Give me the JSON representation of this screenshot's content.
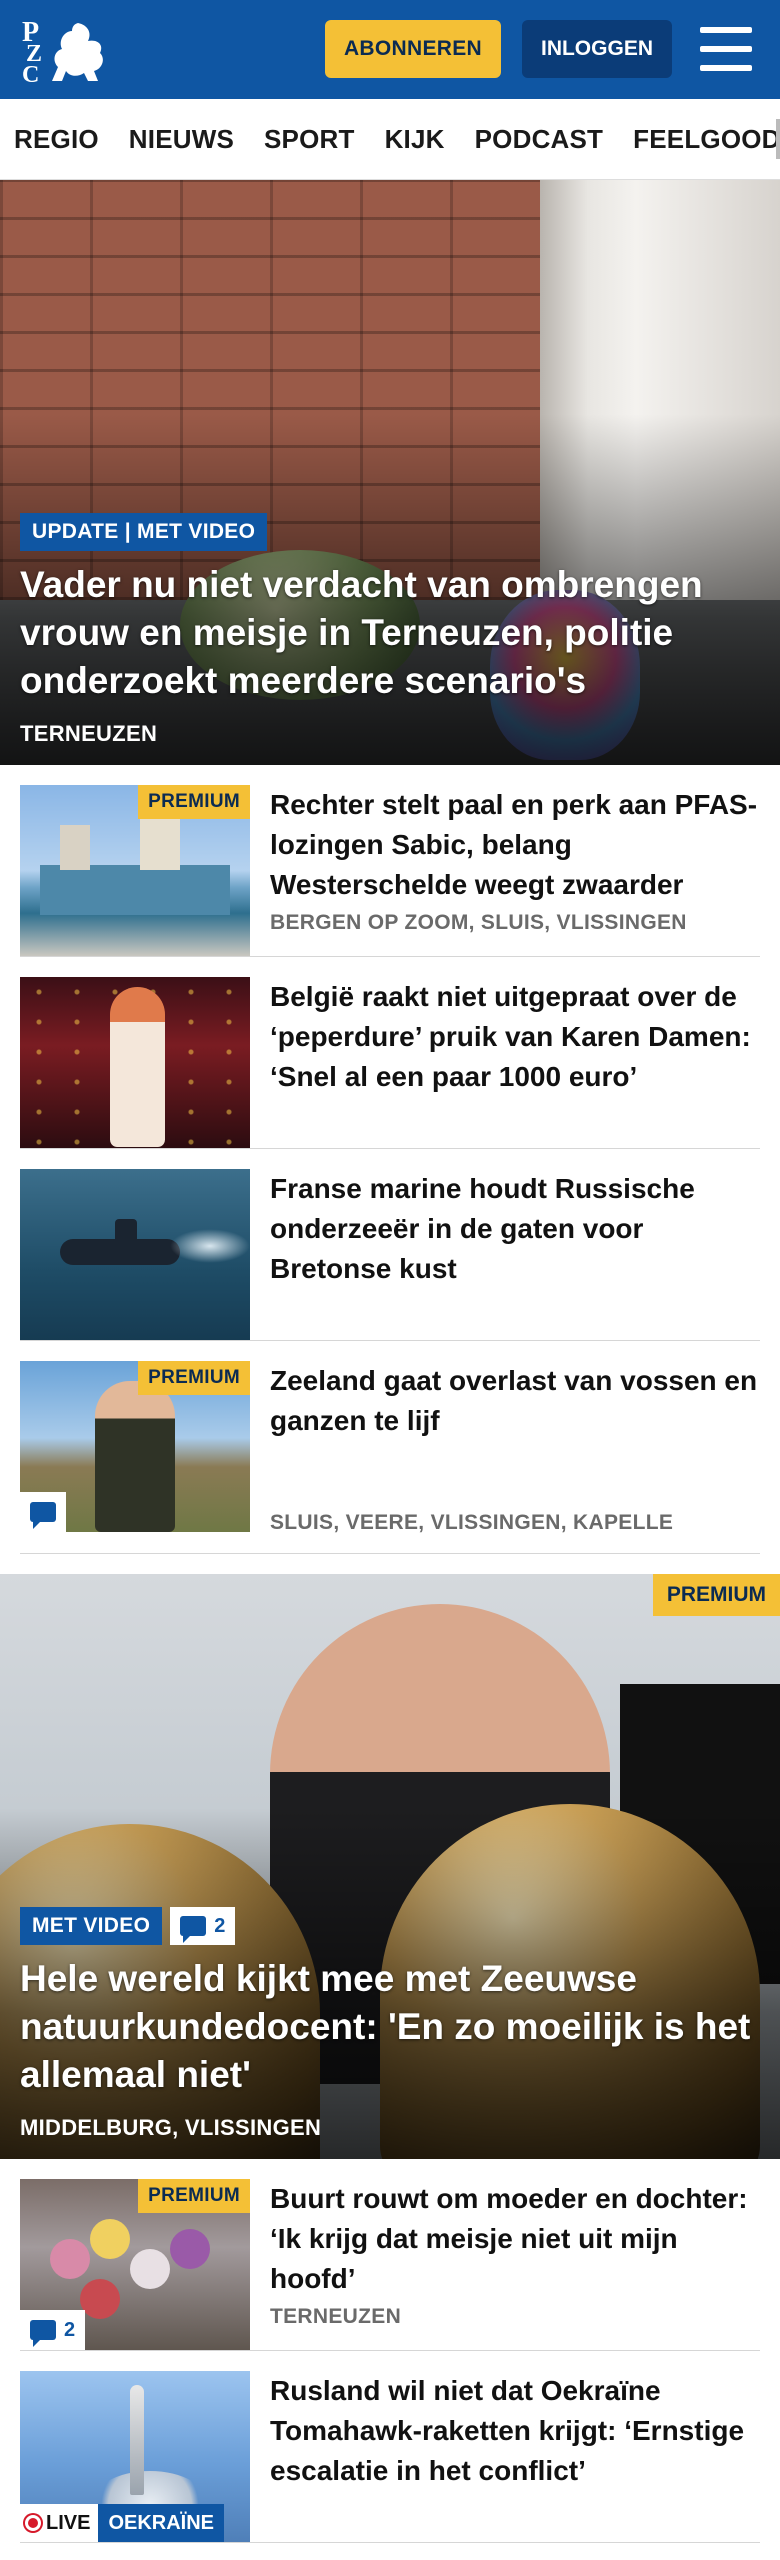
{
  "header": {
    "logo_letters": [
      "P",
      "Z",
      "C"
    ],
    "subscribe_label": "ABONNEREN",
    "login_label": "INLOGGEN"
  },
  "nav": {
    "items": [
      "REGIO",
      "NIEUWS",
      "SPORT",
      "KIJK",
      "PODCAST",
      "FEELGOOD"
    ]
  },
  "hero1": {
    "tag": "UPDATE | MET VIDEO",
    "title": "Vader nu niet verdacht van ombrengen vrouw en meisje in Terneuzen, politie onderzoekt meerdere scenario's",
    "location": "TERNEUZEN"
  },
  "articles1": [
    {
      "title": "Rechter stelt paal en perk aan PFAS-lozingen Sabic, belang Westerschelde weegt zwaarder",
      "location": "BERGEN OP ZOOM, SLUIS, VLISSINGEN",
      "premium": "PREMIUM"
    },
    {
      "title": "België raakt niet uitgepraat over de ‘peperdure’ pruik van Karen Damen: ‘Snel al een paar 1000 euro’"
    },
    {
      "title": "Franse marine houdt Russische onderzeeër in de gaten voor Bretonse kust"
    },
    {
      "title": "Zeeland gaat overlast van vossen en ganzen te lijf",
      "location": "SLUIS, VEERE, VLISSINGEN, KAPELLE",
      "premium": "PREMIUM"
    }
  ],
  "hero2": {
    "premium": "PREMIUM",
    "tag": "MET VIDEO",
    "comments": "2",
    "title": "Hele wereld kijkt mee met Zeeuwse natuurkundedocent: 'En zo moeilijk is het allemaal niet'",
    "location": "MIDDELBURG, VLISSINGEN"
  },
  "articles2": [
    {
      "title": "Buurt rouwt om moeder en dochter: ‘Ik krijg dat meisje niet uit mijn hoofd’",
      "location": "TERNEUZEN",
      "premium": "PREMIUM",
      "comments": "2"
    },
    {
      "title": "Rusland wil niet dat Oekraïne Tomahawk-raketten krijgt: ‘Ernstige escalatie in het conflict’",
      "live": "LIVE",
      "topic": "OEKRAÏNE"
    }
  ],
  "colors": {
    "brand_blue": "#0f56a3",
    "premium_yellow": "#f4c036",
    "login_blue": "#0b3c78"
  },
  "icons": [
    "logo-icon",
    "hamburger-icon",
    "comment-icon",
    "live-dot-icon"
  ]
}
